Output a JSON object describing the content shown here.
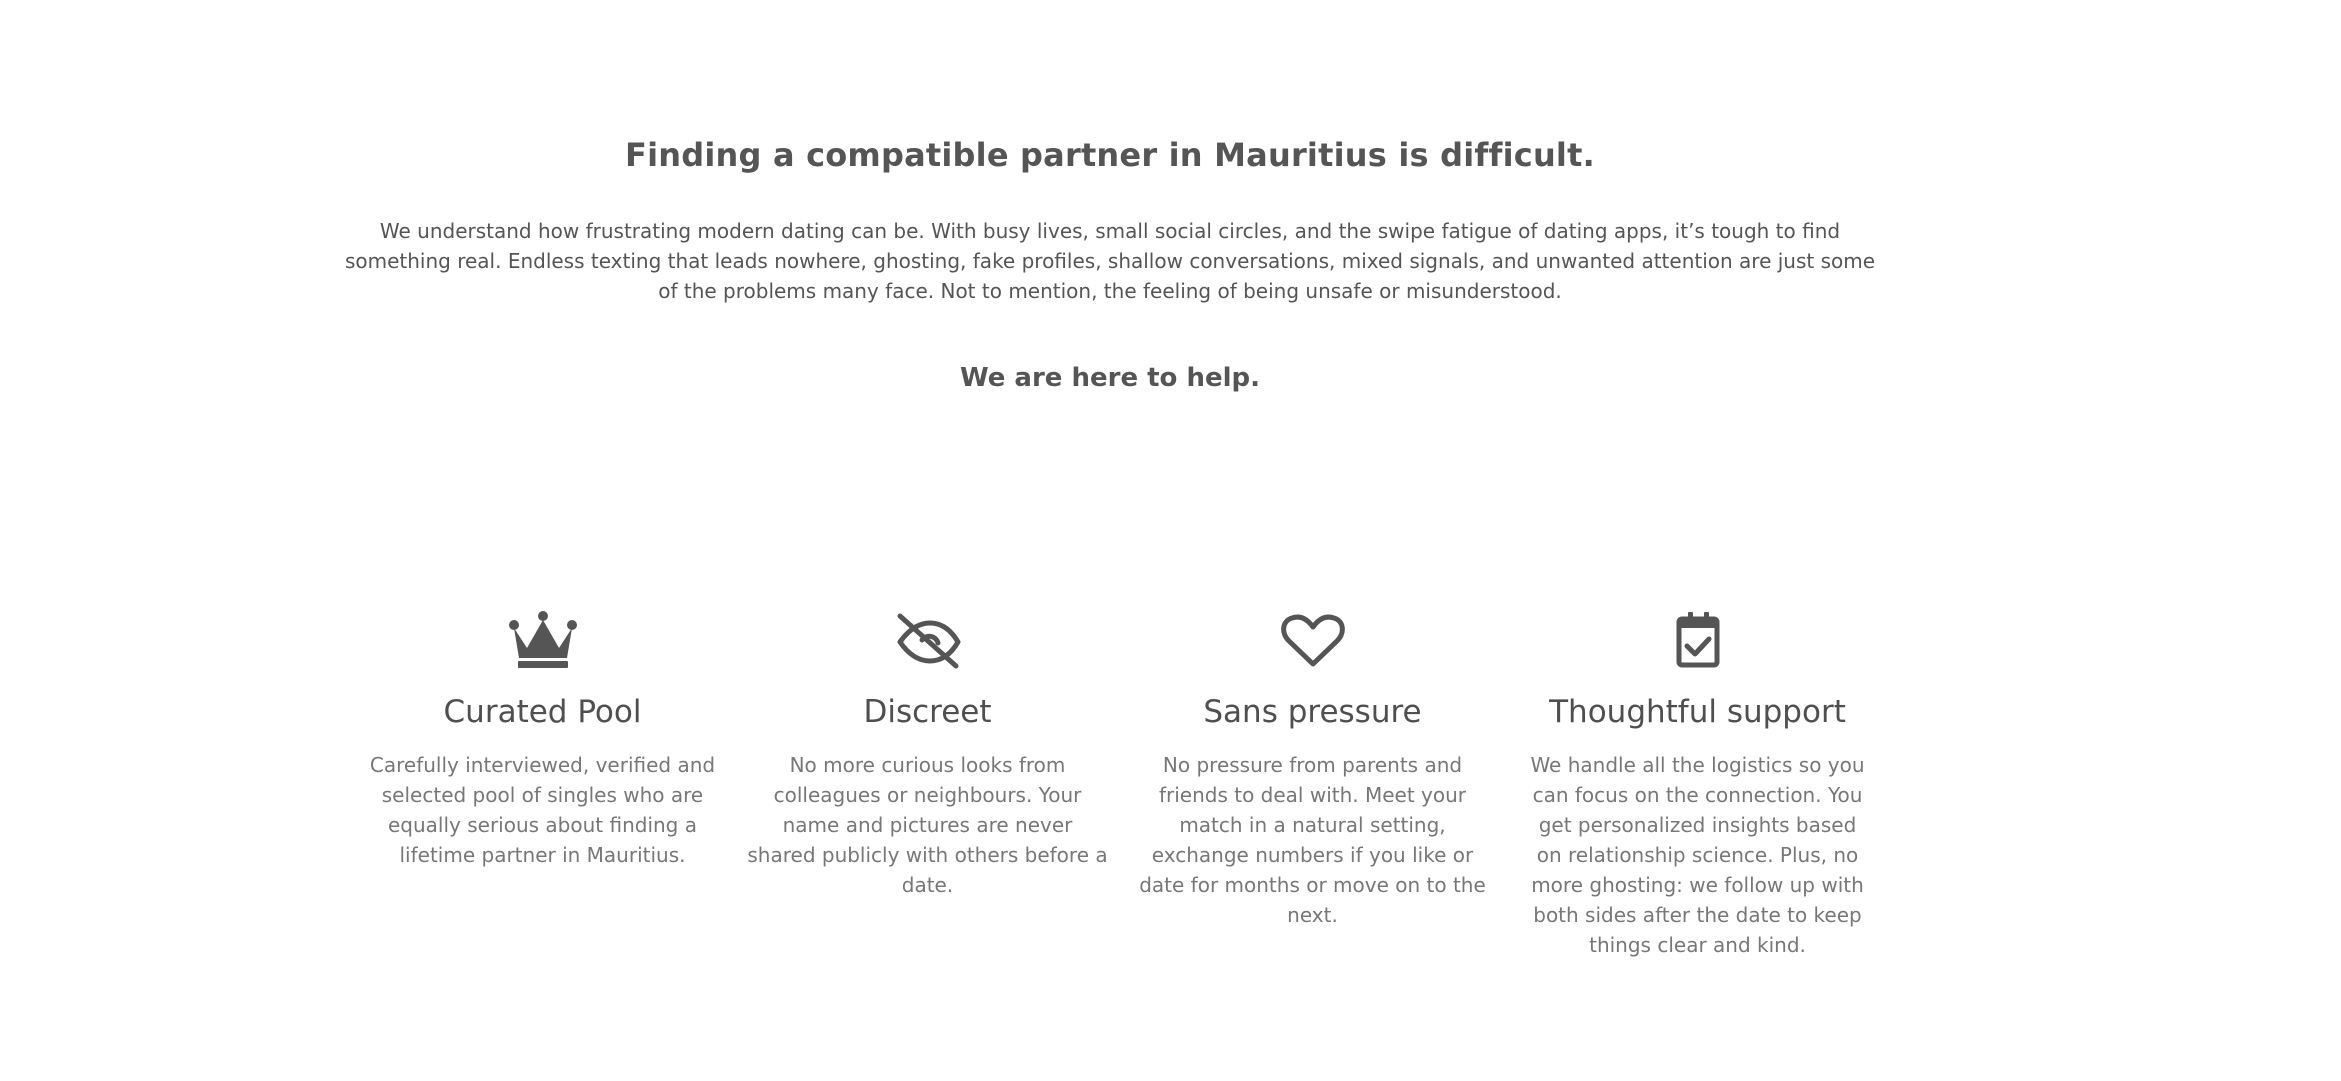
{
  "intro": {
    "headline": "Finding a compatible partner in Mauritius is difficult.",
    "body": "We understand how frustrating modern dating can be. With busy lives, small social circles, and the swipe fatigue of dating apps, it’s tough to find something real. Endless texting that leads nowhere, ghosting, fake profiles, shallow conversations, mixed signals, and unwanted attention are just some of the problems many face. Not to mention, the feeling of being unsafe or misunderstood.",
    "help": "We are here to help."
  },
  "features": [
    {
      "icon": "crown-icon",
      "title": "Curated Pool",
      "text": "Carefully interviewed, verified and selected pool of singles who are equally serious about finding a lifetime partner in Mauritius."
    },
    {
      "icon": "eye-slash-icon",
      "title": "Discreet",
      "text": "No more curious looks from colleagues or neighbours. Your name and pictures are never shared publicly with others before a date."
    },
    {
      "icon": "heart-icon",
      "title": "Sans pressure",
      "text": "No pressure from parents and friends to deal with. Meet your match in a natural setting, exchange numbers if you like or date for months or move on to the next."
    },
    {
      "icon": "calendar-check-icon",
      "title": "Thoughtful support",
      "text": "We handle all the logistics so you can focus on the connection. You get personalized insights based on relationship science. Plus, no more ghosting: we follow up with both sides after the date to keep things clear and kind."
    }
  ],
  "colors": {
    "text": "#555555",
    "muted_text": "#777777",
    "icon": "#555555",
    "background": "#ffffff"
  }
}
